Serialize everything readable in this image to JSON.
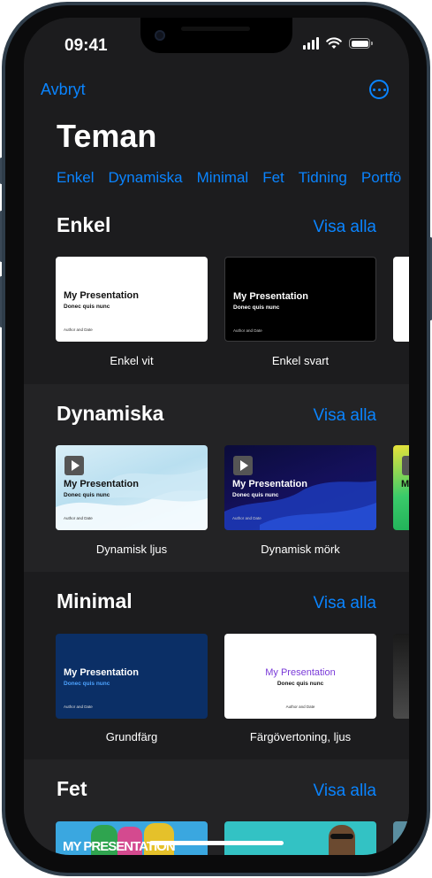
{
  "status": {
    "time": "09:41"
  },
  "nav": {
    "cancel": "Avbryt",
    "more_icon": "ellipsis-circle-icon"
  },
  "title": "Teman",
  "filters": [
    "Enkel",
    "Dynamiska",
    "Minimal",
    "Fet",
    "Tidning",
    "Portfö"
  ],
  "sections": [
    {
      "title": "Enkel",
      "see_all": "Visa alla",
      "themes": [
        {
          "name": "Enkel vit",
          "slide_title": "My Presentation",
          "slide_subtitle": "Donec quis nunc",
          "slide_author": "Author and Date"
        },
        {
          "name": "Enkel svart",
          "slide_title": "My Presentation",
          "slide_subtitle": "Donec quis nunc",
          "slide_author": "Author and Date"
        }
      ]
    },
    {
      "title": "Dynamiska",
      "see_all": "Visa alla",
      "themes": [
        {
          "name": "Dynamisk ljus",
          "slide_title": "My Presentation",
          "slide_subtitle": "Donec quis nunc",
          "slide_author": "Author and Date"
        },
        {
          "name": "Dynamisk mörk",
          "slide_title": "My Presentation",
          "slide_subtitle": "Donec quis nunc",
          "slide_author": "Author and Date"
        }
      ],
      "partial_title": "M"
    },
    {
      "title": "Minimal",
      "see_all": "Visa alla",
      "themes": [
        {
          "name": "Grundfärg",
          "slide_title": "My Presentation",
          "slide_subtitle": "Donec quis nunc",
          "slide_author": "Author and Date"
        },
        {
          "name": "Färgövertoning, ljus",
          "slide_title": "My Presentation",
          "slide_subtitle": "Donec quis nunc",
          "slide_author": "Author and Date"
        }
      ]
    },
    {
      "title": "Fet",
      "see_all": "Visa alla",
      "themes": [
        {
          "slide_title": "MY PRESENTATION"
        }
      ]
    }
  ],
  "colors": {
    "accent": "#0a84ff",
    "background": "#1c1c1e",
    "section_alt": "#232325"
  }
}
